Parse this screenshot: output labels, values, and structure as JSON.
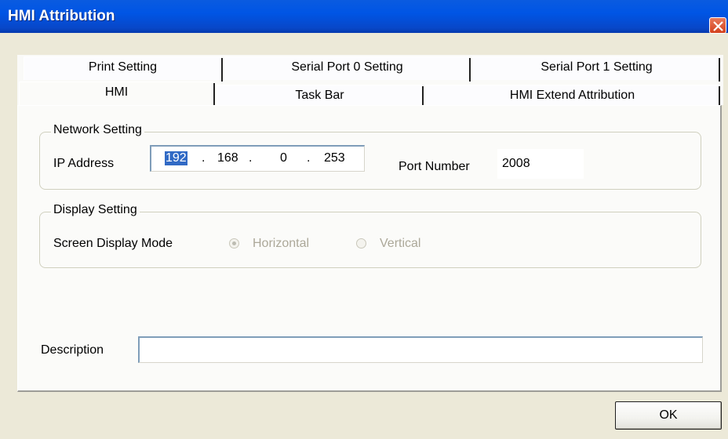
{
  "window": {
    "title": "HMI Attribution"
  },
  "tabs": {
    "row1": [
      "Print Setting",
      "Serial Port 0 Setting",
      "Serial Port 1 Setting"
    ],
    "row2": [
      "HMI",
      "Task Bar",
      "HMI Extend Attribution"
    ],
    "active": "HMI"
  },
  "network": {
    "legend": "Network Setting",
    "ip_label": "IP Address",
    "ip": [
      "192",
      "168",
      "0",
      "253"
    ],
    "ip_separator": ".",
    "port_label": "Port Number",
    "port_value": "2008"
  },
  "display": {
    "legend": "Display Setting",
    "mode_label": "Screen Display Mode",
    "options": [
      "Horizontal",
      "Vertical"
    ],
    "selected": "Horizontal"
  },
  "description": {
    "label": "Description",
    "value": ""
  },
  "buttons": {
    "ok": "OK"
  },
  "colors": {
    "title_bar": "#0055E5",
    "dialog_bg": "#ECE9D8",
    "selection": "#316AC5",
    "close_button": "#D3401C"
  }
}
